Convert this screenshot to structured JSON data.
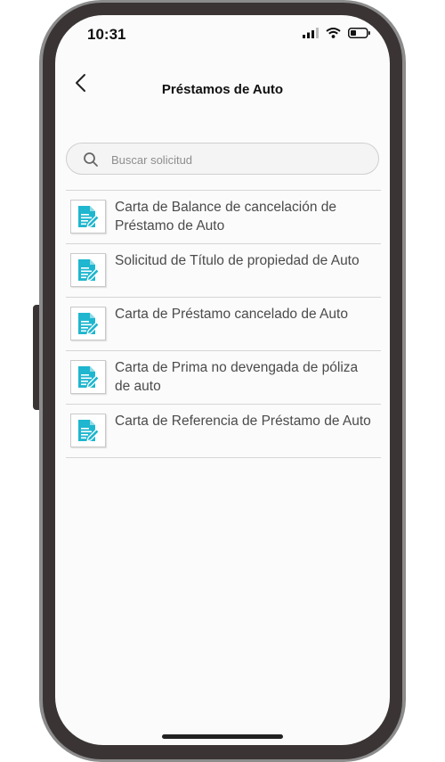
{
  "status_bar": {
    "time": "10:31"
  },
  "header": {
    "title": "Préstamos de Auto"
  },
  "search": {
    "placeholder": "Buscar solicitud",
    "value": ""
  },
  "items": [
    {
      "label": "Carta de Balance de cancelación de Préstamo de Auto"
    },
    {
      "label": "Solicitud de Título de propiedad de Auto"
    },
    {
      "label": "Carta de Préstamo cancelado de Auto"
    },
    {
      "label": "Carta de Prima no devengada de póliza de auto"
    },
    {
      "label": "Carta de Referencia de Préstamo de Auto"
    }
  ],
  "colors": {
    "accent": "#1fb6cf",
    "frame": "#3a3434",
    "screen": "#fbfbfb"
  }
}
